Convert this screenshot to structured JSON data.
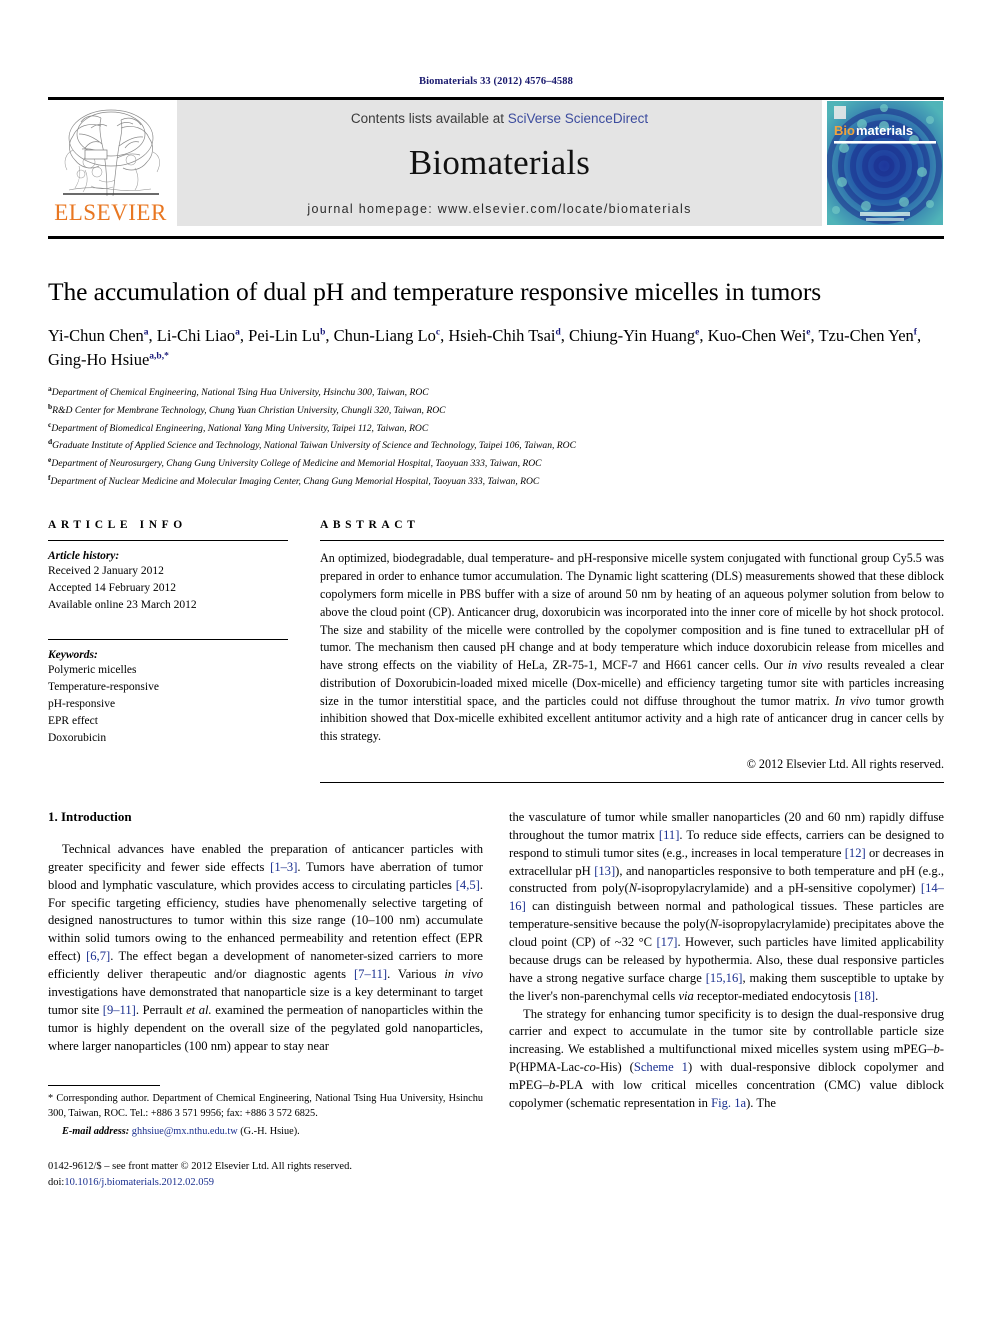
{
  "running_head": "Biomaterials 33 (2012) 4576–4588",
  "masthead": {
    "publisher_name": "ELSEVIER",
    "contents_prefix": "Contents lists available at ",
    "contents_link": "SciVerse ScienceDirect",
    "journal_name": "Biomaterials",
    "homepage": "journal homepage: www.elsevier.com/locate/biomaterials",
    "cover_label_bio": "Bio",
    "cover_label_materials": "materials"
  },
  "article": {
    "title": "The accumulation of dual pH and temperature responsive micelles in tumors",
    "authors": [
      {
        "name": "Yi-Chun Chen",
        "sup": "a",
        "sep": ", "
      },
      {
        "name": "Li-Chi Liao",
        "sup": "a",
        "sep": ", "
      },
      {
        "name": "Pei-Lin Lu",
        "sup": "b",
        "sep": ", "
      },
      {
        "name": "Chun-Liang Lo",
        "sup": "c",
        "sep": ", "
      },
      {
        "name": "Hsieh-Chih Tsai",
        "sup": "d",
        "sep": ", "
      },
      {
        "name": "Chiung-Yin Huang",
        "sup": "e",
        "sep": ", "
      },
      {
        "name": "Kuo-Chen Wei",
        "sup": "e",
        "sep": ", "
      },
      {
        "name": "Tzu-Chen Yen",
        "sup": "f",
        "sep": ", "
      },
      {
        "name": "Ging-Ho Hsiue",
        "sup": "a,b,*",
        "sep": ""
      }
    ],
    "affiliations": [
      {
        "mark": "a",
        "text": "Department of Chemical Engineering, National Tsing Hua University, Hsinchu 300, Taiwan, ROC"
      },
      {
        "mark": "b",
        "text": "R&D Center for Membrane Technology, Chung Yuan Christian University, Chungli 320, Taiwan, ROC"
      },
      {
        "mark": "c",
        "text": "Department of Biomedical Engineering, National Yang Ming University, Taipei 112, Taiwan, ROC"
      },
      {
        "mark": "d",
        "text": "Graduate Institute of Applied Science and Technology, National Taiwan University of Science and Technology, Taipei 106, Taiwan, ROC"
      },
      {
        "mark": "e",
        "text": "Department of Neurosurgery, Chang Gung University College of Medicine and Memorial Hospital, Taoyuan 333, Taiwan, ROC"
      },
      {
        "mark": "f",
        "text": "Department of Nuclear Medicine and Molecular Imaging Center, Chang Gung Memorial Hospital, Taoyuan 333, Taiwan, ROC"
      }
    ]
  },
  "article_info": {
    "heading": "ARTICLE INFO",
    "history_label": "Article history:",
    "history": [
      "Received 2 January 2012",
      "Accepted 14 February 2012",
      "Available online 23 March 2012"
    ],
    "keywords_label": "Keywords:",
    "keywords": [
      "Polymeric micelles",
      "Temperature-responsive",
      "pH-responsive",
      "EPR effect",
      "Doxorubicin"
    ]
  },
  "abstract": {
    "heading": "ABSTRACT",
    "paragraph_1": "An optimized, biodegradable, dual temperature- and pH-responsive micelle system conjugated with functional group Cy5.5 was prepared in order to enhance tumor accumulation. The Dynamic light scattering (DLS) measurements showed that these diblock copolymers form micelle in PBS buffer with a size of around 50 nm by heating of an aqueous polymer solution from below to above the cloud point (CP). Anticancer drug, doxorubicin was incorporated into the inner core of micelle by hot shock protocol. The size and stability of the micelle were controlled by the copolymer composition and is fine tuned to extracellular pH of tumor. The mechanism then caused pH change and at body temperature which induce doxorubicin release from micelles and have strong effects on the viability of HeLa, ZR-75-1, MCF-7 and H661 cancer cells. Our ",
    "italic_1": "in vivo",
    "paragraph_2": " results revealed a clear distribution of Doxorubicin-loaded mixed micelle (Dox-micelle) and efficiency targeting tumor site with particles increasing size in the tumor interstitial space, and the particles could not diffuse throughout the tumor matrix. ",
    "italic_2": "In vivo",
    "paragraph_3": " tumor growth inhibition showed that Dox-micelle exhibited excellent antitumor activity and a high rate of anticancer drug in cancer cells by this strategy.",
    "copyright": "© 2012 Elsevier Ltd. All rights reserved."
  },
  "introduction": {
    "heading": "1. Introduction",
    "left_paragraph": {
      "p1_a": "Technical advances have enabled the preparation of anticancer particles with greater specificity and fewer side effects ",
      "r1": "[1–3]",
      "p1_b": ". Tumors have aberration of tumor blood and lymphatic vasculature, which provides access to circulating particles ",
      "r2": "[4,5]",
      "p1_c": ". For specific targeting efficiency, studies have phenomenally selective targeting of designed nanostructures to tumor within this size range (10–100 nm) accumulate within solid tumors owing to the enhanced permeability and retention effect (EPR effect) ",
      "r3": "[6,7]",
      "p1_d": ". The effect began a development of nanometer-sized carriers to more efficiently deliver therapeutic and/or diagnostic agents ",
      "r4": "[7–11]",
      "p1_e": ". Various ",
      "i1": "in vivo",
      "p1_f": " investigations have demonstrated that nanoparticle size is a key determinant to target tumor site ",
      "r5": "[9–11]",
      "p1_g": ". Perrault ",
      "i2": "et al.",
      "p1_h": " examined the permeation of nanoparticles within the tumor is highly dependent on the overall size of the pegylated gold nanoparticles, where larger nanoparticles (100 nm) appear to stay near"
    },
    "right_paragraph": {
      "p2_a": "the vasculature of tumor while smaller nanoparticles (20 and 60 nm) rapidly diffuse throughout the tumor matrix ",
      "r6": "[11]",
      "p2_b": ". To reduce side effects, carriers can be designed to respond to stimuli tumor sites (e.g., increases in local temperature ",
      "r7": "[12]",
      "p2_c": " or decreases in extracellular pH ",
      "r8": "[13]",
      "p2_d": "), and nanoparticles responsive to both temperature and pH (e.g., constructed from poly(",
      "i3": "N",
      "p2_e": "-isopropylacrylamide) and a pH-sensitive copolymer) ",
      "r9": "[14–16]",
      "p2_f": " can distinguish between normal and pathological tissues. These particles are temperature-sensitive because the poly(",
      "i4": "N",
      "p2_g": "-isopropylacrylamide) precipitates above the cloud point (CP) of ~32 °C ",
      "r10": "[17]",
      "p2_h": ". However, such particles have limited applicability because drugs can be released by hypothermia. Also, these dual responsive particles have a strong negative surface charge ",
      "r11": "[15,16]",
      "p2_i": ", making them susceptible to uptake by the liver's non-parenchymal cells ",
      "i5": "via",
      "p2_j": " receptor-mediated endocytosis ",
      "r12": "[18]",
      "p2_k": "."
    },
    "right_paragraph2": {
      "p3_a": "The strategy for enhancing tumor specificity is to design the dual-responsive drug carrier and expect to accumulate in the tumor site by controllable particle size increasing. We established a multifunctional mixed micelles system using mPEG–",
      "i6": "b",
      "p3_b": "-P(HPMA-Lac-",
      "i7": "co",
      "p3_c": "-His) (",
      "r13": "Scheme 1",
      "p3_d": ") with dual-responsive diblock copolymer and mPEG–",
      "i8": "b",
      "p3_e": "-PLA with low critical micelles concentration (CMC) value diblock copolymer (schematic representation in ",
      "r14": "Fig. 1a",
      "p3_f": "). The"
    }
  },
  "footnote": {
    "star": "*",
    "corresponding": " Corresponding author. Department of Chemical Engineering, National Tsing Hua University, Hsinchu 300, Taiwan, ROC. Tel.: +886 3 571 9956; fax: +886 3 572 6825.",
    "email_label": "E-mail address:",
    "email": "ghhsiue@mx.nthu.edu.tw",
    "email_owner": " (G.-H. Hsiue)."
  },
  "imprint": {
    "line1": "0142-9612/$ – see front matter © 2012 Elsevier Ltd. All rights reserved.",
    "doi_prefix": "doi:",
    "doi": "10.1016/j.biomaterials.2012.02.059"
  },
  "colors": {
    "link_blue": "#1a2f8f",
    "sciencedirect_blue": "#3c4c9e",
    "elsevier_orange": "#e87722",
    "banner_grey": "#e4e4e4",
    "cover_teal": "#2d8f98"
  }
}
